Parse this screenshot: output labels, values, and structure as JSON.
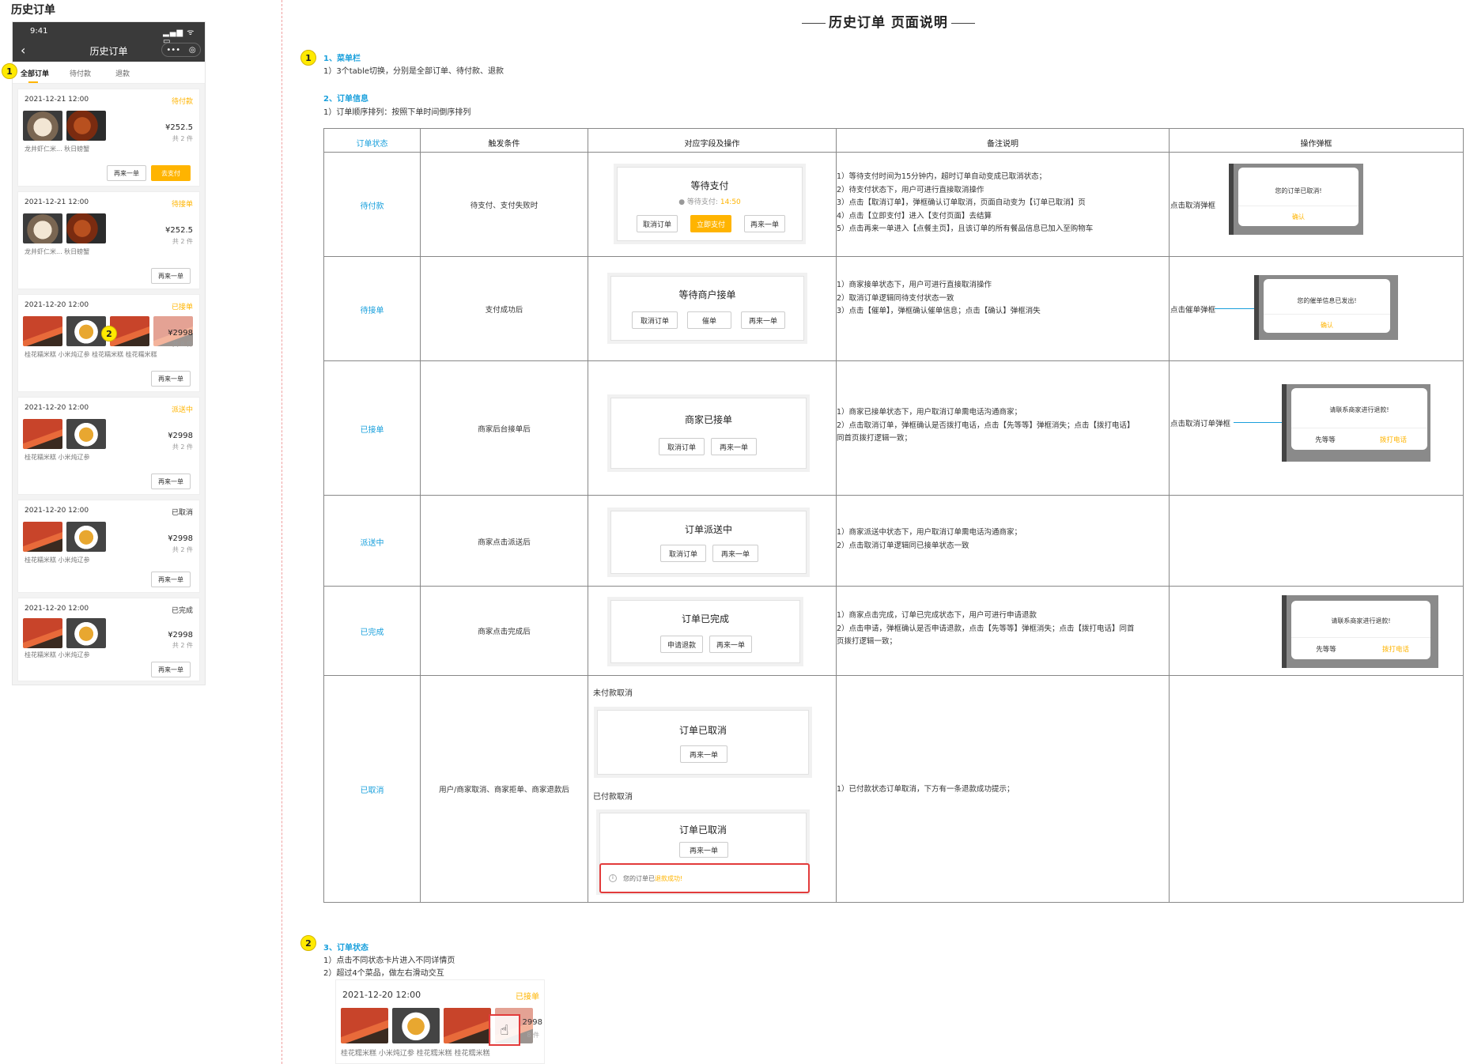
{
  "page_label": "历史订单",
  "phone": {
    "time": "9:41",
    "signal": "▂▄▆ ᯤ ▭",
    "title": "历史订单",
    "capsule_more": "•••",
    "tabs": [
      "全部订单",
      "待付款",
      "退款"
    ],
    "orders": [
      {
        "time": "2021-12-21 12:00",
        "status": "待付款",
        "status_color": "#ffb400",
        "names": "龙井虾仁米...   秋日螃蟹",
        "price": "¥252.5",
        "count": "共 2 件",
        "buttons": [
          "再来一单",
          "去支付"
        ]
      },
      {
        "time": "2021-12-21 12:00",
        "status": "待接单",
        "status_color": "#ffb400",
        "names": "龙井虾仁米...   秋日螃蟹",
        "price": "¥252.5",
        "count": "共 2 件",
        "buttons": [
          "再来一单"
        ]
      },
      {
        "time": "2021-12-20 12:00",
        "status": "已接单",
        "status_color": "#ffb400",
        "names": "桂花糯米糕    小米炖辽参    桂花糯米糕    桂花糯米糕",
        "price": "¥2998",
        "count": "共 8 件",
        "buttons": [
          "再来一单"
        ]
      },
      {
        "time": "2021-12-20 12:00",
        "status": "派送中",
        "status_color": "#ffb400",
        "names": "桂花糯米糕    小米炖辽参",
        "price": "¥2998",
        "count": "共 2 件",
        "buttons": [
          "再来一单"
        ]
      },
      {
        "time": "2021-12-20 12:00",
        "status": "已取消",
        "status_color": "#333333",
        "names": "桂花糯米糕    小米炖辽参",
        "price": "¥2998",
        "count": "共 2 件",
        "buttons": [
          "再来一单"
        ]
      },
      {
        "time": "2021-12-20 12:00",
        "status": "已完成",
        "status_color": "#333333",
        "names": "桂花糯米糕    小米炖辽参",
        "price": "¥2998",
        "count": "共 2 件",
        "buttons": [
          "再来一单"
        ]
      }
    ]
  },
  "markers": [
    "1",
    "2"
  ],
  "doc": {
    "title": "历史订单 页面说明",
    "s1_heading": "1、菜单栏",
    "s1_text": "1）3个table切换，分别是全部订单、待付款、退款",
    "s2_heading": "2、订单信息",
    "s2_text": "1）订单顺序排列：按照下单时间倒序排列",
    "s3_heading": "3、订单状态",
    "s3_text1": "1）点击不同状态卡片进入不同详情页",
    "s3_text2": "2）超过4个菜品，做左右滑动交互"
  },
  "table": {
    "headers": [
      "订单状态",
      "触发条件",
      "对应字段及操作",
      "备注说明",
      "操作弹框"
    ],
    "rows": [
      {
        "status": "待付款",
        "trigger": "待支付、支付失败时",
        "mock_title": "等待支付",
        "mock_sub_label": "等待支付:",
        "mock_sub_time": "14:50",
        "buttons": [
          "取消订单",
          "立即支付",
          "再来一单"
        ],
        "notes": [
          "1）等待支付时间为15分钟内，超时订单自动变成已取消状态；",
          "2）待支付状态下，用户可进行直接取消操作",
          "3）点击【取消订单】，弹框确认订单取消，页面自动变为【订单已取消】页",
          "4）点击【立即支付】进入【支付页面】去结算",
          "5）点击再来一单进入【点餐主页】，且该订单的所有餐品信息已加入至购物车"
        ],
        "op_label": "点击取消弹框",
        "dialog_text": "您的订单已取消!",
        "dialog_ok": "确认"
      },
      {
        "status": "待接单",
        "trigger": "支付成功后",
        "mock_title": "等待商户接单",
        "buttons": [
          "取消订单",
          "催单",
          "再来一单"
        ],
        "notes": [
          "1）商家接单状态下，用户可进行直接取消操作",
          "2）取消订单逻辑同待支付状态一致",
          "3）点击【催单】，弹框确认催单信息；点击【确认】弹框消失"
        ],
        "op_label": "点击催单弹框",
        "dialog_text": "您的催单信息已发出!",
        "dialog_ok": "确认"
      },
      {
        "status": "已接单",
        "trigger": "商家后台接单后",
        "mock_title": "商家已接单",
        "buttons": [
          "取消订单",
          "再来一单"
        ],
        "notes": [
          "1）商家已接单状态下，用户取消订单需电话沟通商家；",
          "2）点击取消订单，弹框确认是否拨打电话，点击【先等等】弹框消失；点击【拨打电话】",
          "同首页拨打逻辑一致；"
        ],
        "op_label": "点击取消订单弹框",
        "dialog_text": "请联系商家进行退款!",
        "dialog_left": "先等等",
        "dialog_right": "拨打电话"
      },
      {
        "status": "派送中",
        "trigger": "商家点击派送后",
        "mock_title": "订单派送中",
        "buttons": [
          "取消订单",
          "再来一单"
        ],
        "notes": [
          "1）商家派送中状态下，用户取消订单需电话沟通商家；",
          "2）点击取消订单逻辑同已接单状态一致"
        ]
      },
      {
        "status": "已完成",
        "trigger": "商家点击完成后",
        "mock_title": "订单已完成",
        "buttons": [
          "申请退款",
          "再来一单"
        ],
        "notes": [
          "1）商家点击完成，订单已完成状态下，用户可进行申请退款",
          "2）点击申请，弹框确认是否申请退款，点击【先等等】弹框消失；点击【拨打电话】同首",
          "页拨打逻辑一致；"
        ],
        "dialog_text": "请联系商家进行退款!",
        "dialog_left": "先等等",
        "dialog_right": "拨打电话"
      },
      {
        "status": "已取消",
        "trigger": "用户/商家取消、商家拒单、商家退款后",
        "sub1": "未付款取消",
        "mock_title": "订单已取消",
        "button": "再来一单",
        "sub2": "已付款取消",
        "mock2_title": "订单已取消",
        "button2": "再来一单",
        "toast_pre": "您的订单已",
        "toast_hl": "退款成功!",
        "notes": [
          "1）已付款状态订单取消，下方有一条退款成功提示；"
        ]
      }
    ]
  },
  "bottom_card": {
    "time": "2021-12-20 12:00",
    "status": "已接单",
    "price": "2998",
    "count": "8 件",
    "names": "桂花糯米糕      小米炖辽参      桂花糯米糕      桂花糯米糕",
    "hand_icon": "hand-pointer-icon"
  },
  "colors": {
    "accent": "#ffb400",
    "link": "#1aa0dc",
    "alert": "#e23b3b"
  }
}
